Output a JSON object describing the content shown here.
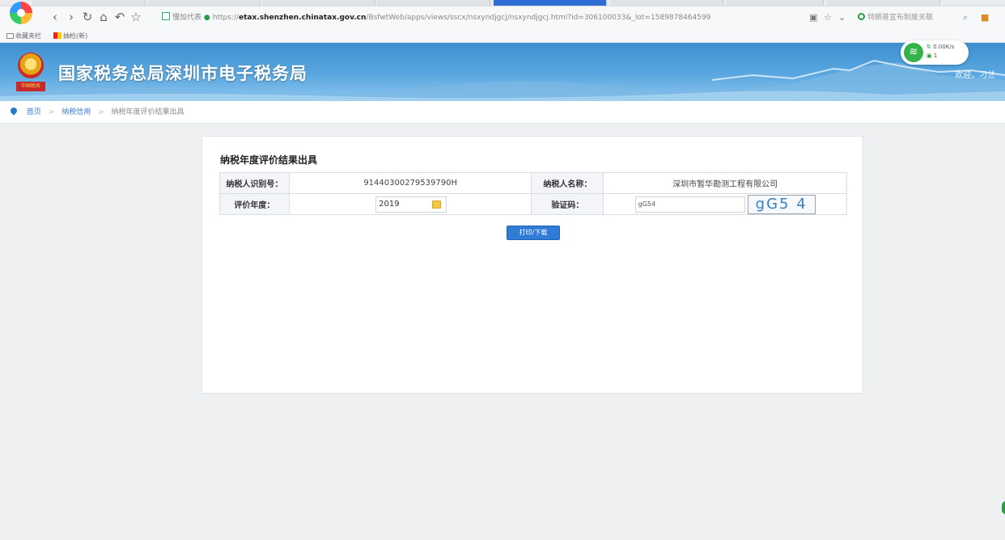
{
  "browser": {
    "address": {
      "prefix_badge": "慢加代表",
      "scheme": "https://",
      "host": "etax.shenzhen.chinatax.gov.cn",
      "path": "/BsfwtWeb/apps/views/sscx/nsxyndjgcj/nsxyndjgcj.html?id=306100033&_lot=1589878464599"
    },
    "search_placeholder": "特朗普宣布制度关联",
    "bookmarks": [
      {
        "label": "收藏夹栏"
      },
      {
        "label": "抽检(新)"
      }
    ]
  },
  "site": {
    "title": "国家税务总局深圳市电子税务局",
    "emblem_text": "中国税务",
    "welcome": "欢迎，刁兰",
    "network": {
      "speed": "0.00K/s",
      "count": "1"
    }
  },
  "breadcrumb": {
    "items": [
      "首页",
      "纳税信用",
      "纳税年度评价结果出具"
    ],
    "separator": ">"
  },
  "form": {
    "title": "纳税年度评价结果出具",
    "taxpayer_id_label": "纳税人识别号：",
    "taxpayer_id_value": "91440300279539790H",
    "taxpayer_name_label": "纳税人名称：",
    "taxpayer_name_value": "深圳市暂华勘测工程有限公司",
    "year_label": "评价年度：",
    "year_value": "2019",
    "captcha_label": "验证码：",
    "captcha_input_value": "gG54",
    "captcha_image_text": "gG5 4",
    "submit_label": "打印/下载"
  },
  "colors": {
    "header_blue": "#3e8fd0",
    "primary_button": "#2f7bd6",
    "link": "#3a7bd5"
  }
}
